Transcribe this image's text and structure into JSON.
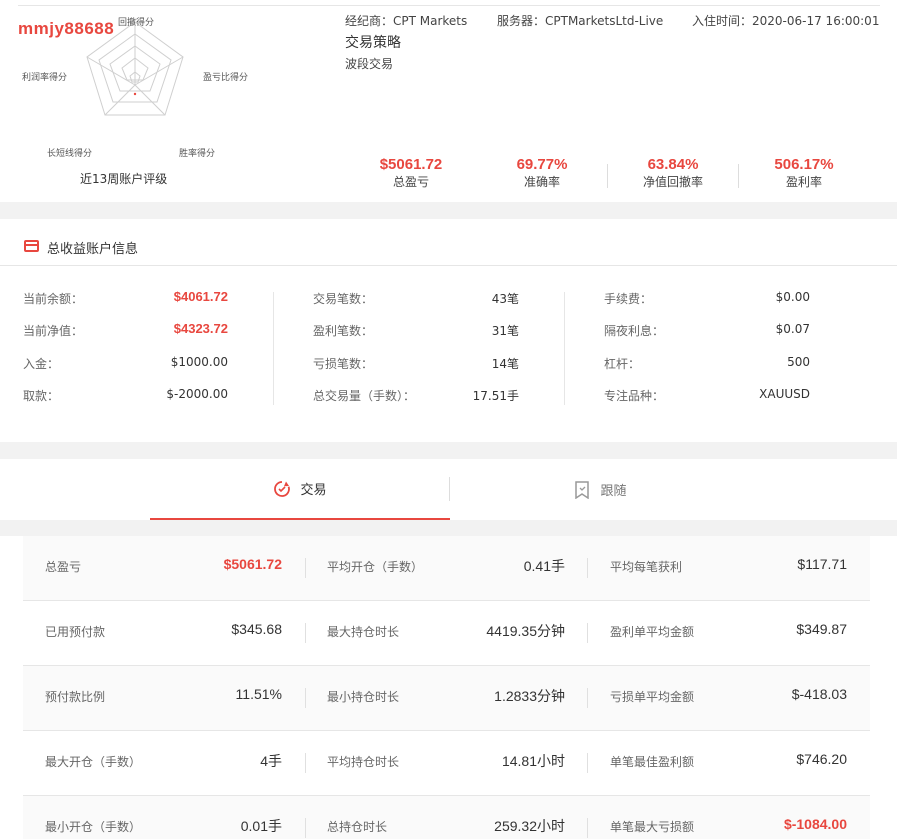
{
  "profile": {
    "username": "mmjy88688",
    "radar_caption": "近13周账户评级",
    "radar_labels": [
      "回撤得分",
      "盈亏比得分",
      "胜率得分",
      "长短线得分",
      "利润率得分"
    ],
    "broker": "经纪商：CPT Markets",
    "server": "服务器：CPTMarketsLtd-Live",
    "join_time": "入住时间：2020-06-17 16:00:01",
    "strategy_title": "交易策略",
    "strategy_value": "波段交易",
    "stats": [
      {
        "value": "$5061.72",
        "label": "总盈亏"
      },
      {
        "value": "69.77%",
        "label": "准确率"
      },
      {
        "value": "63.84%",
        "label": "净值回撤率"
      },
      {
        "value": "506.17%",
        "label": "盈利率"
      }
    ]
  },
  "account": {
    "title": "总收益账户信息",
    "col1": [
      {
        "label": "当前余额：",
        "value": "$4061.72"
      },
      {
        "label": "当前净值：",
        "value": "$4323.72"
      },
      {
        "label": "入金：",
        "value": "$1000.00"
      },
      {
        "label": "取款：",
        "value": "$-2000.00"
      }
    ],
    "col2": [
      {
        "label": "交易笔数：",
        "value": "43笔"
      },
      {
        "label": "盈利笔数：",
        "value": "31笔"
      },
      {
        "label": "亏损笔数：",
        "value": "14笔"
      },
      {
        "label": "总交易量（手数）：",
        "value": "17.51手"
      }
    ],
    "col3": [
      {
        "label": "手续费：",
        "value": "$0.00"
      },
      {
        "label": "隔夜利息：",
        "value": "$0.07"
      },
      {
        "label": "杠杆：",
        "value": "500"
      },
      {
        "label": "专注品种：",
        "value": "XAUUSD"
      }
    ]
  },
  "tabs": [
    {
      "label": "交易",
      "icon": "trade-icon",
      "active": true
    },
    {
      "label": "跟随",
      "icon": "bookmark-icon",
      "active": false
    }
  ],
  "table": [
    [
      {
        "label": "总盈亏",
        "value": "$5061.72"
      },
      {
        "label": "平均开仓（手数）",
        "value": "0.41手"
      },
      {
        "label": "平均每笔获利",
        "value": "$117.71"
      }
    ],
    [
      {
        "label": "已用预付款",
        "value": "$345.68"
      },
      {
        "label": "最大持仓时长",
        "value": "4419.35分钟"
      },
      {
        "label": "盈利单平均金额",
        "value": "$349.87"
      }
    ],
    [
      {
        "label": "预付款比例",
        "value": "11.51%"
      },
      {
        "label": "最小持仓时长",
        "value": "1.2833分钟"
      },
      {
        "label": "亏损单平均金额",
        "value": "$-418.03"
      }
    ],
    [
      {
        "label": "最大开仓（手数）",
        "value": "4手"
      },
      {
        "label": "平均持仓时长",
        "value": "14.81小时"
      },
      {
        "label": "单笔最佳盈利额",
        "value": "$746.20"
      }
    ],
    [
      {
        "label": "最小开仓（手数）",
        "value": "0.01手"
      },
      {
        "label": "总持仓时长",
        "value": "259.32小时"
      },
      {
        "label": "单笔最大亏损额",
        "value": "$-1084.00"
      }
    ]
  ],
  "colors": {
    "accent": "#e8473f",
    "text": "#333333",
    "muted": "#666666"
  }
}
